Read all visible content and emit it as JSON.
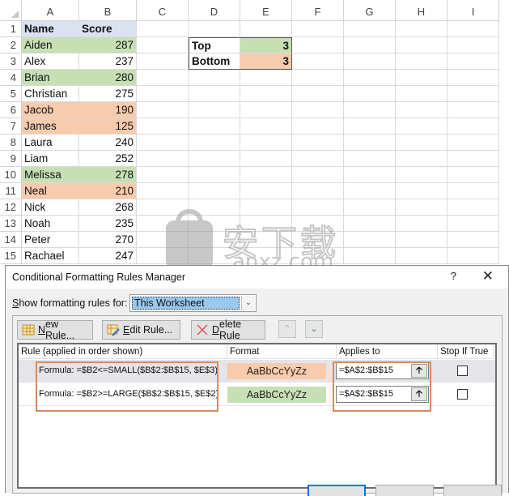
{
  "sheet": {
    "columns": [
      "A",
      "B",
      "C",
      "D",
      "E",
      "F",
      "G",
      "H",
      "I"
    ],
    "rows": [
      {
        "n": "1",
        "name": "Name",
        "score": "Score",
        "fill": "header"
      },
      {
        "n": "2",
        "name": "Aiden",
        "score": "287",
        "fill": "green"
      },
      {
        "n": "3",
        "name": "Alex",
        "score": "237",
        "fill": "none"
      },
      {
        "n": "4",
        "name": "Brian",
        "score": "280",
        "fill": "green"
      },
      {
        "n": "5",
        "name": "Christian",
        "score": "275",
        "fill": "none"
      },
      {
        "n": "6",
        "name": "Jacob",
        "score": "190",
        "fill": "orange"
      },
      {
        "n": "7",
        "name": "James",
        "score": "125",
        "fill": "orange"
      },
      {
        "n": "8",
        "name": "Laura",
        "score": "240",
        "fill": "none"
      },
      {
        "n": "9",
        "name": "Liam",
        "score": "252",
        "fill": "none"
      },
      {
        "n": "10",
        "name": "Melissa",
        "score": "278",
        "fill": "green"
      },
      {
        "n": "11",
        "name": "Neal",
        "score": "210",
        "fill": "orange"
      },
      {
        "n": "12",
        "name": "Nick",
        "score": "268",
        "fill": "none"
      },
      {
        "n": "13",
        "name": "Noah",
        "score": "235",
        "fill": "none"
      },
      {
        "n": "14",
        "name": "Peter",
        "score": "270",
        "fill": "none"
      },
      {
        "n": "15",
        "name": "Rachael",
        "score": "247",
        "fill": "none"
      }
    ],
    "side_table": [
      {
        "label": "Top",
        "value": "3",
        "fill": "green"
      },
      {
        "label": "Bottom",
        "value": "3",
        "fill": "orange"
      }
    ],
    "colors": {
      "header": "#d9e1f2",
      "green": "#c6e0b4",
      "orange": "#f8cbad"
    }
  },
  "watermark": {
    "cn": "安下载",
    "en": "anxz.com"
  },
  "dialog": {
    "title": "Conditional Formatting Rules Manager",
    "help": "?",
    "close": "✕",
    "show_label_prefix": "S",
    "show_label_rest": "how formatting rules for:",
    "scope_value": "This Worksheet",
    "toolbar": {
      "new_u": "N",
      "new_rest": "ew Rule...",
      "edit_u": "E",
      "edit_rest": "dit Rule...",
      "delete_u": "D",
      "delete_rest": "elete Rule",
      "up": "^",
      "down": "⌄"
    },
    "columns": [
      "Rule (applied in order shown)",
      "Format",
      "Applies to",
      "Stop If True"
    ],
    "rules": [
      {
        "formula": "Formula: =$B2<=SMALL($B$2:$B$15, $E$3)",
        "preview": "AaBbCcYyZz",
        "fill": "#f8cbad",
        "applies_to": "=$A$2:$B$15",
        "stop_if_true": false,
        "selected": true
      },
      {
        "formula": "Formula: =$B2>=LARGE($B$2:$B$15, $E$2)",
        "preview": "AaBbCcYyZz",
        "fill": "#c6e0b4",
        "applies_to": "=$A$2:$B$15",
        "stop_if_true": false,
        "selected": false
      }
    ],
    "highlight_color": "#d98a5c"
  }
}
